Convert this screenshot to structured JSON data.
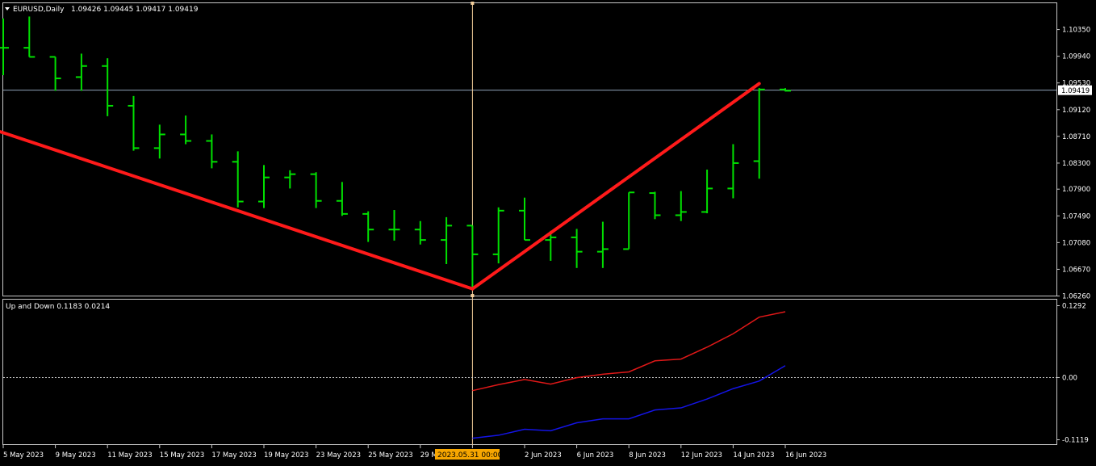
{
  "header": {
    "symbol_label": "EURUSD,Daily",
    "ohlc_label": "1.09426 1.09445 1.09417 1.09419"
  },
  "indicator": {
    "label": "Up and Down 0.1183 0.0214"
  },
  "crosshair": {
    "date_label": "2023.05.31 00:00"
  },
  "colors": {
    "background": "#000000",
    "bars": "#00e000",
    "trendline": "#ff1a1a",
    "up_line": "#e01818",
    "down_line": "#1414e6",
    "grid_text": "#ffffff",
    "price_line": "#8fa3b8"
  },
  "chart_data": [
    {
      "type": "ohlc",
      "symbol": "EURUSD",
      "timeframe": "Daily",
      "current_price": 1.09419,
      "current_price_label": "1.09419",
      "ylim": [
        1.0626,
        1.1076
      ],
      "y_ticks": [
        "1.10350",
        "1.09940",
        "1.09530",
        "1.09120",
        "1.08710",
        "1.08300",
        "1.07900",
        "1.07490",
        "1.07080",
        "1.06670",
        "1.06260"
      ],
      "y_tick_values": [
        1.1035,
        1.0994,
        1.0953,
        1.0912,
        1.0871,
        1.083,
        1.079,
        1.0749,
        1.0708,
        1.0667,
        1.0626
      ],
      "x_labels": [
        {
          "label": "5 May 2023",
          "index": 0
        },
        {
          "label": "9 May 2023",
          "index": 2
        },
        {
          "label": "11 May 2023",
          "index": 4
        },
        {
          "label": "15 May 2023",
          "index": 6
        },
        {
          "label": "17 May 2023",
          "index": 8
        },
        {
          "label": "19 May 2023",
          "index": 10
        },
        {
          "label": "23 May 2023",
          "index": 12
        },
        {
          "label": "25 May 2023",
          "index": 14
        },
        {
          "label": "29 Ma",
          "index": 16
        },
        {
          "label": "023",
          "index": 18
        },
        {
          "label": "2 Jun 2023",
          "index": 20
        },
        {
          "label": "6 Jun 2023",
          "index": 22
        },
        {
          "label": "8 Jun 2023",
          "index": 24
        },
        {
          "label": "12 Jun 2023",
          "index": 26
        },
        {
          "label": "14 Jun 2023",
          "index": 28
        },
        {
          "label": "16 Jun 2023",
          "index": 30
        }
      ],
      "bars": [
        {
          "index": 0,
          "o": 1.1007,
          "h": 1.1052,
          "l": 1.0965,
          "c": 1.1007
        },
        {
          "index": 1,
          "o": 1.1007,
          "h": 1.1055,
          "l": 1.0993,
          "c": 1.0993
        },
        {
          "index": 2,
          "o": 1.0993,
          "h": 1.0993,
          "l": 1.0941,
          "c": 1.096
        },
        {
          "index": 3,
          "o": 1.0962,
          "h": 1.0998,
          "l": 1.0941,
          "c": 1.0979
        },
        {
          "index": 4,
          "o": 1.0979,
          "h": 1.0991,
          "l": 1.0902,
          "c": 1.0918
        },
        {
          "index": 5,
          "o": 1.0918,
          "h": 1.0933,
          "l": 1.0849,
          "c": 1.0853
        },
        {
          "index": 6,
          "o": 1.0853,
          "h": 1.0889,
          "l": 1.0837,
          "c": 1.0874
        },
        {
          "index": 7,
          "o": 1.0874,
          "h": 1.0903,
          "l": 1.0859,
          "c": 1.0864
        },
        {
          "index": 8,
          "o": 1.0864,
          "h": 1.0874,
          "l": 1.0822,
          "c": 1.0832
        },
        {
          "index": 9,
          "o": 1.0832,
          "h": 1.0848,
          "l": 1.0762,
          "c": 1.0771
        },
        {
          "index": 10,
          "o": 1.0771,
          "h": 1.0827,
          "l": 1.0761,
          "c": 1.0808
        },
        {
          "index": 11,
          "o": 1.0808,
          "h": 1.0819,
          "l": 1.0791,
          "c": 1.0813
        },
        {
          "index": 12,
          "o": 1.0813,
          "h": 1.0816,
          "l": 1.0761,
          "c": 1.0772
        },
        {
          "index": 13,
          "o": 1.0772,
          "h": 1.0801,
          "l": 1.0749,
          "c": 1.0752
        },
        {
          "index": 14,
          "o": 1.0752,
          "h": 1.0756,
          "l": 1.0709,
          "c": 1.0728
        },
        {
          "index": 15,
          "o": 1.0728,
          "h": 1.0758,
          "l": 1.0711,
          "c": 1.0728
        },
        {
          "index": 16,
          "o": 1.0728,
          "h": 1.0741,
          "l": 1.0705,
          "c": 1.0712
        },
        {
          "index": 17,
          "o": 1.0712,
          "h": 1.0747,
          "l": 1.0675,
          "c": 1.0734
        },
        {
          "index": 18,
          "o": 1.0734,
          "h": 1.0734,
          "l": 1.0635,
          "c": 1.069
        },
        {
          "index": 19,
          "o": 1.069,
          "h": 1.0762,
          "l": 1.0676,
          "c": 1.0757
        },
        {
          "index": 20,
          "o": 1.0757,
          "h": 1.0777,
          "l": 1.0712,
          "c": 1.0712
        },
        {
          "index": 21,
          "o": 1.0712,
          "h": 1.0726,
          "l": 1.068,
          "c": 1.0716
        },
        {
          "index": 22,
          "o": 1.0716,
          "h": 1.0729,
          "l": 1.0669,
          "c": 1.0694
        },
        {
          "index": 23,
          "o": 1.0694,
          "h": 1.074,
          "l": 1.0669,
          "c": 1.0698
        },
        {
          "index": 24,
          "o": 1.0698,
          "h": 1.0785,
          "l": 1.0698,
          "c": 1.0785
        },
        {
          "index": 25,
          "o": 1.0784,
          "h": 1.0786,
          "l": 1.0744,
          "c": 1.075
        },
        {
          "index": 26,
          "o": 1.075,
          "h": 1.0787,
          "l": 1.0741,
          "c": 1.0755
        },
        {
          "index": 27,
          "o": 1.0755,
          "h": 1.082,
          "l": 1.0753,
          "c": 1.0791
        },
        {
          "index": 28,
          "o": 1.0791,
          "h": 1.0859,
          "l": 1.0776,
          "c": 1.083
        },
        {
          "index": 29,
          "o": 1.0833,
          "h": 1.0945,
          "l": 1.0806,
          "c": 1.0943
        },
        {
          "index": 30,
          "o": 1.0943,
          "h": 1.0945,
          "l": 1.094,
          "c": 1.0941
        }
      ],
      "trendlines": [
        {
          "from": {
            "index": -0.1,
            "price": 1.0878
          },
          "to": {
            "index": 18,
            "price": 1.0637
          }
        },
        {
          "from": {
            "index": 18,
            "price": 1.0637
          },
          "to": {
            "index": 29,
            "price": 1.0952
          }
        }
      ]
    },
    {
      "type": "line",
      "name": "Up and Down",
      "ylim": [
        -0.1119,
        0.1292
      ],
      "y_ticks": [
        "0.1292",
        "0.00",
        "-0.1119"
      ],
      "y_tick_values": [
        0.1292,
        0.0,
        -0.1119
      ],
      "zero_line": true,
      "series": [
        {
          "color": "up_line",
          "points": [
            {
              "index": 18,
              "value": -0.0236
            },
            {
              "index": 19,
              "value": -0.0128
            },
            {
              "index": 20,
              "value": -0.0036
            },
            {
              "index": 21,
              "value": -0.0118
            },
            {
              "index": 22,
              "value": -0.0003
            },
            {
              "index": 23,
              "value": 0.006
            },
            {
              "index": 24,
              "value": 0.0101
            },
            {
              "index": 25,
              "value": 0.03
            },
            {
              "index": 26,
              "value": 0.0332
            },
            {
              "index": 27,
              "value": 0.0546
            },
            {
              "index": 28,
              "value": 0.0787
            },
            {
              "index": 29,
              "value": 0.1086
            },
            {
              "index": 30,
              "value": 0.1183
            }
          ]
        },
        {
          "color": "down_line",
          "points": [
            {
              "index": 18,
              "value": -0.1092
            },
            {
              "index": 19,
              "value": -0.1038
            },
            {
              "index": 20,
              "value": -0.093
            },
            {
              "index": 21,
              "value": -0.0957
            },
            {
              "index": 22,
              "value": -0.0814
            },
            {
              "index": 23,
              "value": -0.0743
            },
            {
              "index": 24,
              "value": -0.0743
            },
            {
              "index": 25,
              "value": -0.0584
            },
            {
              "index": 26,
              "value": -0.0546
            },
            {
              "index": 27,
              "value": -0.0386
            },
            {
              "index": 28,
              "value": -0.02
            },
            {
              "index": 29,
              "value": -0.0063
            },
            {
              "index": 30,
              "value": 0.0214
            }
          ]
        }
      ]
    }
  ]
}
